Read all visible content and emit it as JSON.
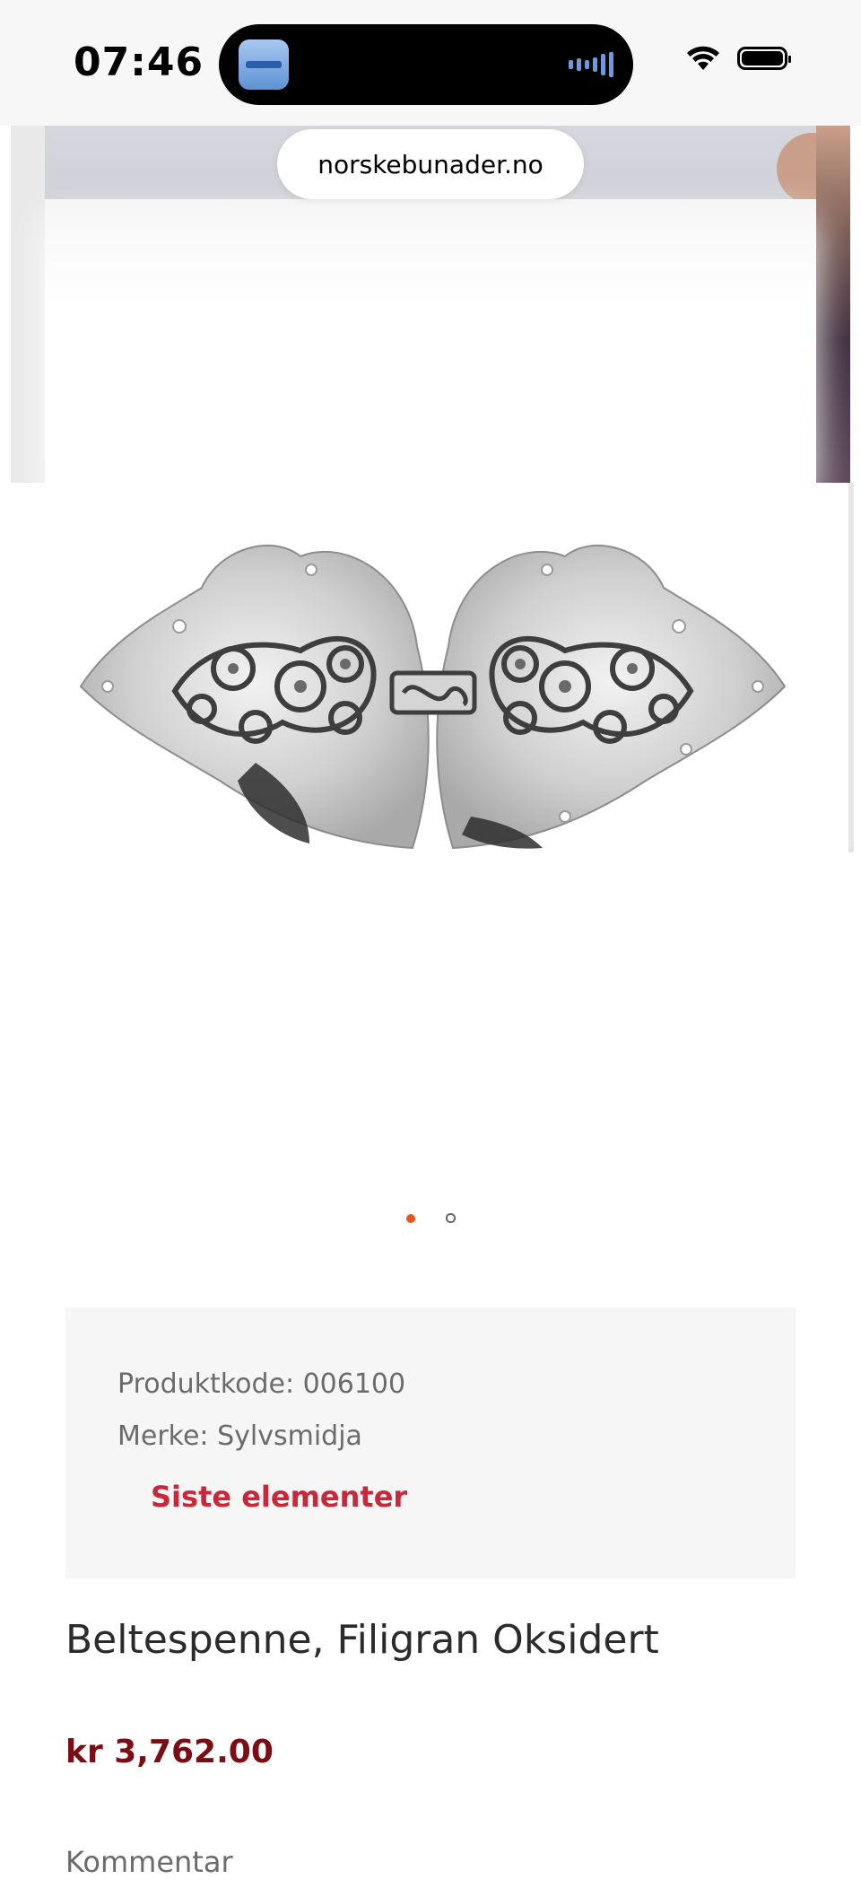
{
  "status_bar": {
    "time": "07:46",
    "icons": [
      "app-icon",
      "audio-wave-icon",
      "wifi-icon",
      "battery-icon"
    ]
  },
  "browser": {
    "url": "norskebunader.no"
  },
  "gallery": {
    "image_alt": "belt-buckle-filigree-image",
    "total_slides": 2,
    "active_slide": 1,
    "accent_color": "#e8541e"
  },
  "product": {
    "code_line": "Produktkode: 006100",
    "brand_line": "Merke: Sylvsmidja",
    "stock_status": "Siste elementer",
    "title": "Beltespenne, Filigran Oksidert",
    "price": "kr 3,762.00",
    "comment_label": "Kommentar"
  },
  "colors": {
    "stock": "#c8283a",
    "price": "#7a0e14",
    "info_bg": "#f6f6f6"
  }
}
